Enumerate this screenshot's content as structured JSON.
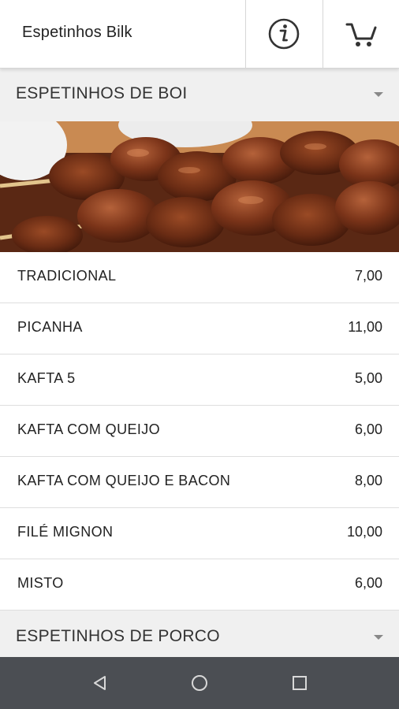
{
  "header": {
    "title": "Espetinhos Bilk",
    "info_icon": "info-icon",
    "cart_icon": "cart-icon"
  },
  "sections": [
    {
      "title": "ESPETINHOS DE BOI",
      "image": "grilled-beef-skewers-photo",
      "items": [
        {
          "name": "TRADICIONAL",
          "price": "7,00"
        },
        {
          "name": "PICANHA",
          "price": "11,00"
        },
        {
          "name": "KAFTA 5",
          "price": "5,00"
        },
        {
          "name": "KAFTA COM QUEIJO",
          "price": "6,00"
        },
        {
          "name": "KAFTA COM QUEIJO E BACON",
          "price": "8,00"
        },
        {
          "name": "FILÉ MIGNON",
          "price": "10,00"
        },
        {
          "name": "MISTO",
          "price": "6,00"
        }
      ]
    },
    {
      "title": "ESPETINHOS DE PORCO"
    }
  ],
  "navbar": {
    "back_icon": "back-icon",
    "home_icon": "home-icon",
    "recents_icon": "recents-icon"
  },
  "colors": {
    "section_header_bg": "#f0f0f0",
    "navbar_bg": "#4b4e53",
    "divider": "#dedede"
  }
}
